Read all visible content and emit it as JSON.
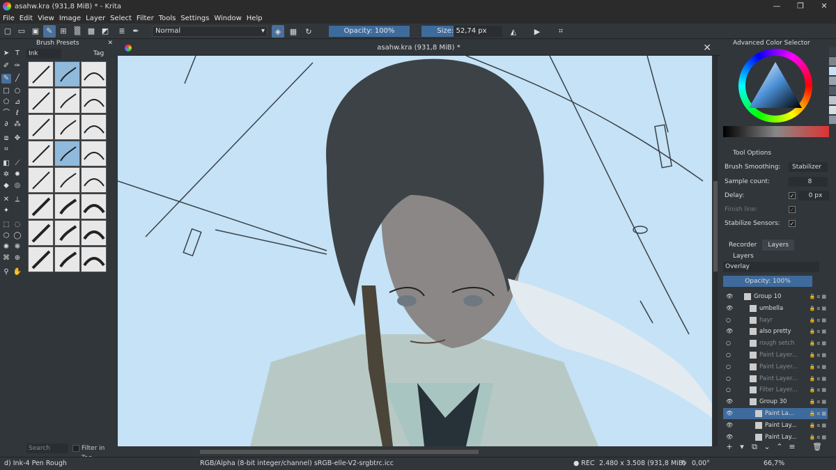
{
  "window": {
    "title": "asahw.kra (931,8 MiB) * - Krita",
    "controls": [
      "—",
      "❐",
      "✕"
    ]
  },
  "menu": [
    "File",
    "Edit",
    "View",
    "Image",
    "Layer",
    "Select",
    "Filter",
    "Tools",
    "Settings",
    "Window",
    "Help"
  ],
  "toolbar": {
    "blend_mode": "Normal",
    "opacity_label": "Opacity: 100%",
    "opacity_fraction": 1.0,
    "size_label": "Size: 52,74 px",
    "size_fraction": 0.4
  },
  "presets": {
    "title": "Brush Presets",
    "filter_value": "Ink",
    "tag_label": "Tag",
    "search_placeholder": "Search",
    "filter_in_tag_label": "Filter in Tag"
  },
  "document": {
    "title": "asahw.kra (931,8 MiB) *",
    "close": "✕"
  },
  "color_selector": {
    "title": "Advanced Color Selector",
    "swatches": [
      "#3a3f45",
      "#7a8590",
      "#c5e2f6",
      "#9aa5b0",
      "#505a64",
      "#bcc6d0",
      "#d9dee3",
      "#8a96a3"
    ]
  },
  "tool_options": {
    "title": "Tool Options",
    "brush_smoothing_label": "Brush Smoothing:",
    "brush_smoothing_value": "Stabilizer",
    "sample_count_label": "Sample count:",
    "sample_count_value": "8",
    "delay_label": "Delay:",
    "delay_value": "0 px",
    "finish_line_label": "Finish line:",
    "stabilize_sensors_label": "Stabilize Sensors:"
  },
  "right_tabs": [
    "Recorder",
    "Layers"
  ],
  "layers_panel": {
    "title": "Layers",
    "blend_mode": "Overlay",
    "opacity_label": "Opacity:  100%",
    "layers": [
      {
        "name": "Group 10",
        "visible": true,
        "indent": 0
      },
      {
        "name": "umbella",
        "visible": true,
        "indent": 1
      },
      {
        "name": "hayr",
        "visible": false,
        "indent": 1
      },
      {
        "name": "also pretty",
        "visible": true,
        "indent": 1
      },
      {
        "name": "rough setch",
        "visible": false,
        "indent": 1
      },
      {
        "name": "Paint Layer...",
        "visible": false,
        "indent": 1
      },
      {
        "name": "Paint Layer...",
        "visible": false,
        "indent": 1
      },
      {
        "name": "Paint Layer...",
        "visible": false,
        "indent": 1
      },
      {
        "name": "Filter Layer...",
        "visible": false,
        "indent": 1
      },
      {
        "name": "Group 30",
        "visible": true,
        "indent": 1
      },
      {
        "name": "Paint La...",
        "visible": true,
        "indent": 2,
        "selected": true
      },
      {
        "name": "Paint Lay...",
        "visible": true,
        "indent": 2
      },
      {
        "name": "Paint Lay...",
        "visible": true,
        "indent": 2
      }
    ]
  },
  "status": {
    "brush": "d) Ink-4 Pen Rough",
    "color_space": "RGB/Alpha (8-bit integer/channel)  sRGB-elle-V2-srgbtrc.icc",
    "rec": "● REC",
    "dimensions": "2.480 x 3.508 (931,8 MiB)",
    "rotation": "0,00°",
    "zoom": "66,7%"
  }
}
